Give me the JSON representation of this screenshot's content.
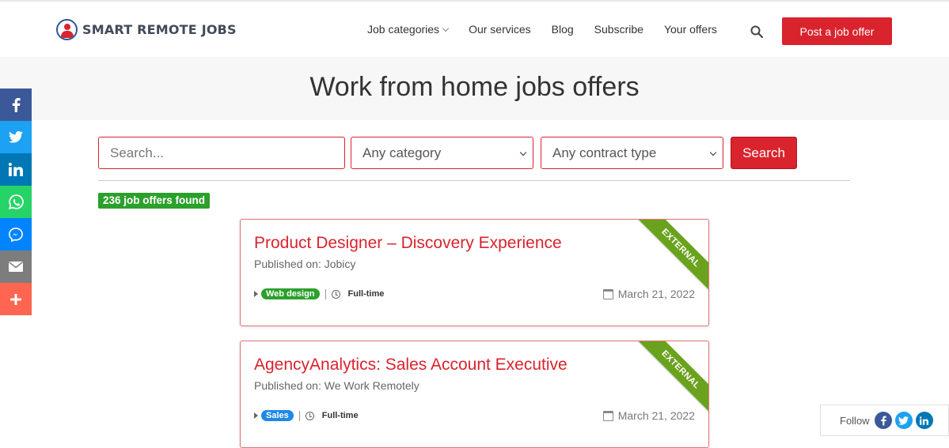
{
  "brand": {
    "name": "SMART REMOTE JOBS"
  },
  "nav": {
    "items": [
      "Job categories",
      "Our services",
      "Blog",
      "Subscribe",
      "Your offers"
    ],
    "post_label": "Post a job offer"
  },
  "hero": {
    "title": "Work from home jobs offers"
  },
  "filters": {
    "search_placeholder": "Search...",
    "category": "Any category",
    "contract": "Any contract type",
    "search_label": "Search"
  },
  "results": {
    "count_label": "236 job offers found"
  },
  "jobs": [
    {
      "title": "Product Designer – Discovery Experience",
      "published": "Published on: Jobicy",
      "category": "Web design",
      "category_color": "#2ca02c",
      "contract": "Full-time",
      "date": "March 21, 2022",
      "ribbon": "EXTERNAL"
    },
    {
      "title": "AgencyAnalytics: Sales Account Executive",
      "published": "Published on: We Work Remotely",
      "category": "Sales",
      "category_color": "#1e88e5",
      "contract": "Full-time",
      "date": "March 21, 2022",
      "ribbon": "EXTERNAL"
    }
  ],
  "share": {
    "icons": [
      "facebook-icon",
      "twitter-icon",
      "linkedin-icon",
      "whatsapp-icon",
      "messenger-icon",
      "email-icon",
      "more-icon"
    ],
    "colors": [
      "#3b5998",
      "#1da1f2",
      "#0077b5",
      "#25d366",
      "#0084ff",
      "#7d7d7d",
      "#ff6550"
    ]
  },
  "follow": {
    "label": "Follow"
  },
  "colors": {
    "accent": "#d9232d",
    "badge": "#2ca02c",
    "ribbon": "#6aa21d"
  }
}
